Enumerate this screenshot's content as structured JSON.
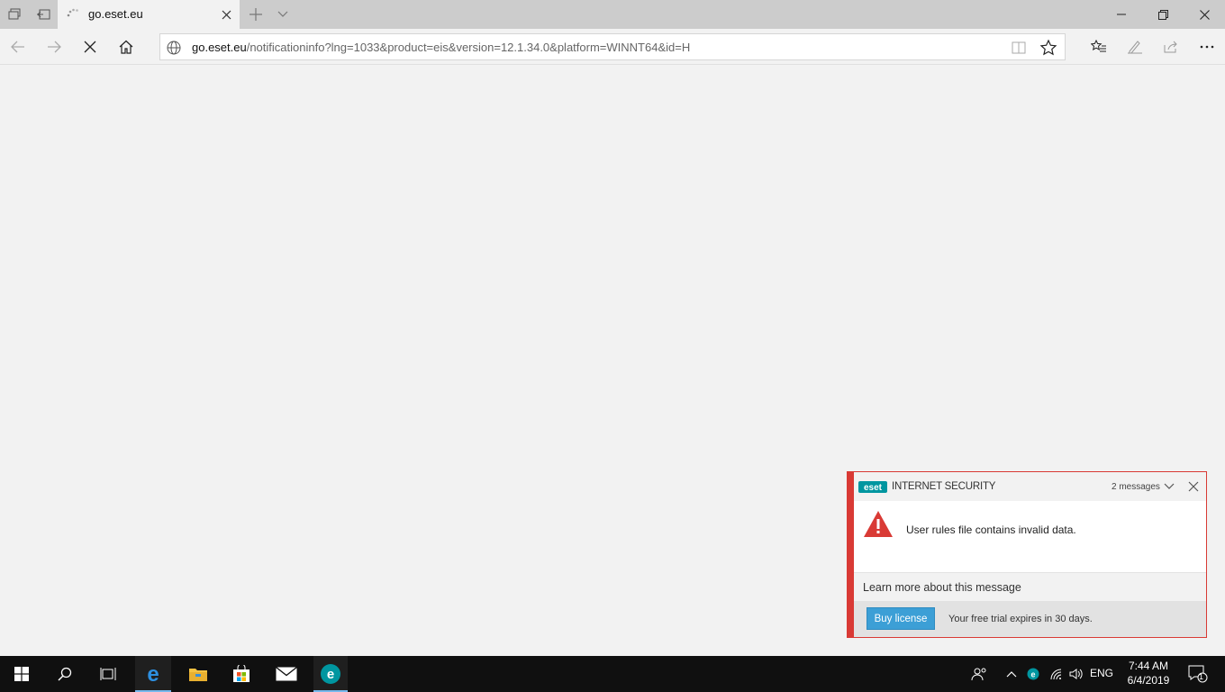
{
  "tab": {
    "title": "go.eset.eu"
  },
  "address": {
    "host": "go.eset.eu",
    "path": "/notificationinfo?lng=1033&product=eis&version=12.1.34.0&platform=WINNT64&id=H"
  },
  "icons": {
    "tab_actions": [
      "tabs-aside-icon",
      "set-tabs-aside-icon"
    ],
    "tab_controls": [
      "new-tab-icon",
      "tab-preview-icon"
    ],
    "window": [
      "minimize-icon",
      "restore-icon",
      "close-icon"
    ],
    "nav": [
      "back-icon",
      "forward-icon",
      "stop-icon",
      "home-icon"
    ],
    "toolbar": [
      "favorites-icon",
      "notes-icon",
      "share-icon",
      "more-icon"
    ]
  },
  "notification": {
    "product": "INTERNET SECURITY",
    "message_count": "2 messages",
    "message": "User rules file contains invalid data.",
    "learn_more": "Learn more about this message",
    "buy_label": "Buy license",
    "trial_text": "Your free trial expires in 30 days.",
    "accent_color": "#d93a35",
    "button_color": "#3c9fd6"
  },
  "taskbar": {
    "language": "ENG",
    "time": "7:44 AM",
    "date": "6/4/2019",
    "notification_badge": "1"
  }
}
